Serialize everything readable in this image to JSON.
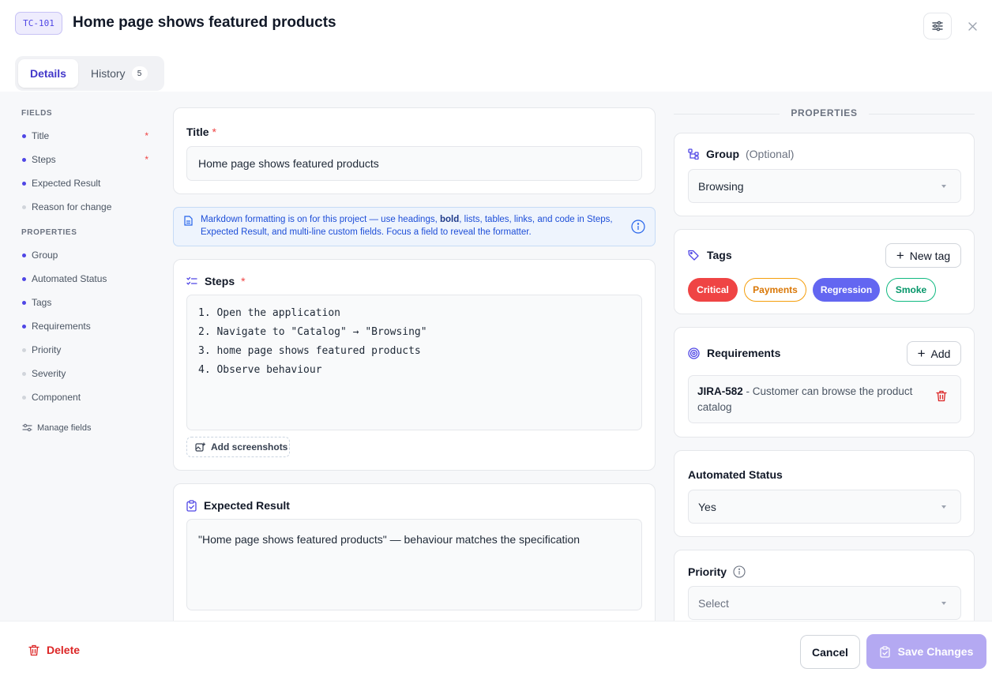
{
  "header": {
    "badge": "TC-101",
    "title": "Home page shows featured products",
    "tabs": [
      {
        "label": "Details"
      },
      {
        "label": "History",
        "count": "5"
      }
    ]
  },
  "sidebar": {
    "fields_heading": "FIELDS",
    "fields": [
      {
        "label": "Title",
        "required": "*"
      },
      {
        "label": "Steps",
        "required": "*"
      },
      {
        "label": "Expected Result"
      },
      {
        "label": "Reason for change"
      }
    ],
    "properties_heading": "PROPERTIES",
    "properties": [
      {
        "label": "Group"
      },
      {
        "label": "Automated Status"
      },
      {
        "label": "Tags"
      },
      {
        "label": "Requirements"
      },
      {
        "label": "Priority"
      },
      {
        "label": "Severity"
      },
      {
        "label": "Component"
      }
    ],
    "manage_label": "Manage fields"
  },
  "main": {
    "title_label": "Title",
    "title_value": "Home page shows featured products",
    "banner_pre": "Markdown formatting is on for this project — use headings, ",
    "banner_bold": "bold",
    "banner_post": ", lists, tables, links, and code in Steps, Expected Result, and multi-line custom fields. Focus a field to reveal the formatter.",
    "steps_label": "Steps",
    "steps": [
      "1. Open the application",
      "2. Navigate to \"Catalog\" → \"Browsing\"",
      "3. home page shows featured products",
      "4. Observe behaviour"
    ],
    "add_screenshots": "Add screenshots",
    "expected_label": "Expected Result",
    "expected_value": "\"Home page shows featured products\" — behaviour matches the specification",
    "required_mark": "*"
  },
  "properties": {
    "heading": "PROPERTIES",
    "group_label": "Group",
    "group_optional": "(Optional)",
    "group_value": "Browsing",
    "tags_label": "Tags",
    "new_tag": "New tag",
    "tags": [
      {
        "label": "Critical",
        "color": "#ef4444"
      },
      {
        "label": "Payments",
        "color": "#f59e0b"
      },
      {
        "label": "Regression",
        "color": "#6366f1"
      },
      {
        "label": "Smoke",
        "color": "#10b981"
      }
    ],
    "requirements_label": "Requirements",
    "add_label": "Add",
    "requirement_id": "JIRA-582",
    "requirement_text": " - Customer can browse the product catalog",
    "automated_label": "Automated Status",
    "automated_value": "Yes",
    "priority_label": "Priority",
    "priority_placeholder": "Select"
  },
  "footer": {
    "delete_label": "Delete",
    "cancel_label": "Cancel",
    "save_label": "Save Changes"
  },
  "colors": {
    "accent": "#4f46e5",
    "danger": "#dc2626",
    "save_disabled": "#b4a9f2"
  }
}
